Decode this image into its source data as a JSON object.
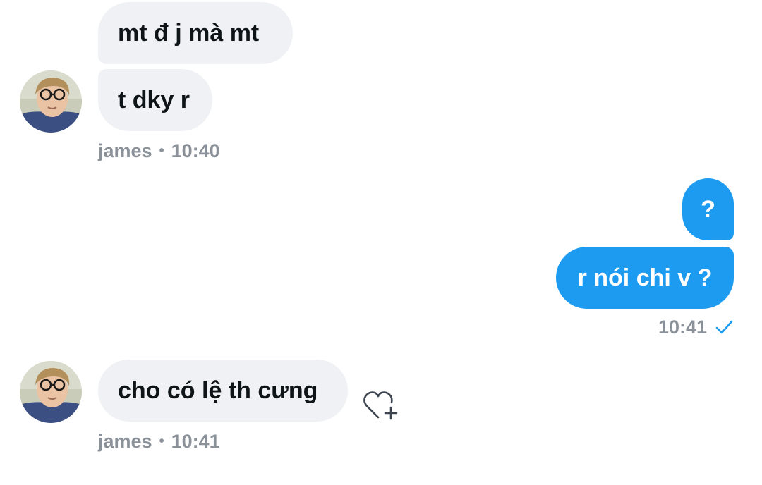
{
  "messages": [
    {
      "side": "in",
      "text": "mt đ j mà mt"
    },
    {
      "side": "in",
      "text": "t dky r",
      "meta": {
        "sender": "james",
        "time": "10:40"
      }
    },
    {
      "side": "out",
      "text": "?"
    },
    {
      "side": "out",
      "text": "r nói chi v ?",
      "meta": {
        "time": "10:41",
        "status_icon": "sent-check-icon"
      }
    },
    {
      "side": "in",
      "text": "cho có lệ th cưng",
      "meta": {
        "sender": "james",
        "time": "10:41"
      },
      "reaction_icon": "heart-add-icon"
    }
  ],
  "colors": {
    "incoming_bubble": "#eff1f4",
    "outgoing_bubble": "#1d9bf0",
    "meta_text": "#8b9199",
    "check": "#1d9bf0"
  }
}
